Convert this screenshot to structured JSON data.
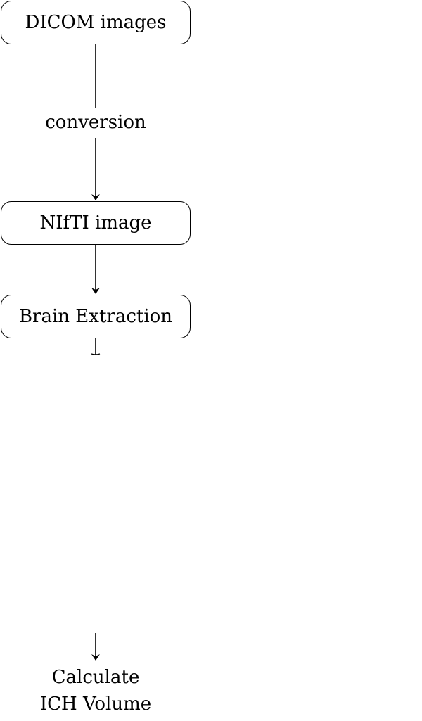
{
  "diagram": {
    "nodes": {
      "dicom": "DICOM images",
      "nifti": "NIfTI image",
      "brain_extraction": "Brain Extraction"
    },
    "edges": {
      "dicom_to_nifti_label": "conversion"
    },
    "final_step": {
      "line1": "Calculate",
      "line2": "ICH Volume"
    }
  }
}
